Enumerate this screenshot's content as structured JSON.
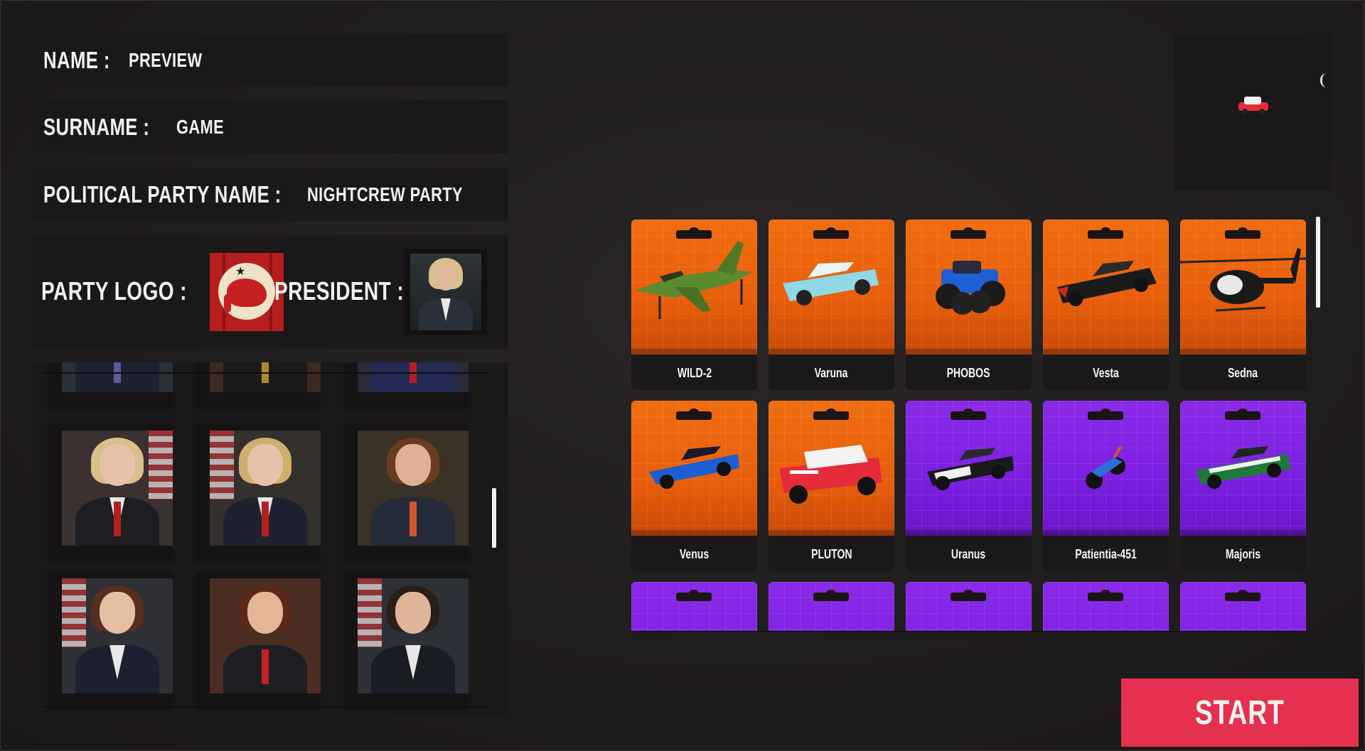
{
  "form": {
    "name_label": "NAME :",
    "name_value": "PREVIEW",
    "surname_label": "SURNAME :",
    "surname_value": "GAME",
    "party_label": "POLITICAL PARTY NAME :",
    "party_value": "NIGHTCREW PARTY",
    "logo_label": "PARTY LOGO :",
    "president_label": "PRESIDENT :"
  },
  "vehicles": [
    {
      "name": "WILD-2",
      "theme": "orange",
      "icon": "jet-icon",
      "color": "#5c8a2e"
    },
    {
      "name": "Varuna",
      "theme": "orange",
      "icon": "classic-car-icon",
      "color": "#8fd8e6"
    },
    {
      "name": "PHOBOS",
      "theme": "orange",
      "icon": "monster-truck-icon",
      "color": "#1f5fd6"
    },
    {
      "name": "Vesta",
      "theme": "orange",
      "icon": "muscle-car-icon",
      "color": "#1a1a1a"
    },
    {
      "name": "Sedna",
      "theme": "orange",
      "icon": "helicopter-icon",
      "color": "#1a1a1a"
    },
    {
      "name": "Venus",
      "theme": "orange",
      "icon": "sports-car-icon",
      "color": "#1d5fd0"
    },
    {
      "name": "PLUTON",
      "theme": "orange",
      "icon": "mini-car-icon",
      "color": "#e52a3a"
    },
    {
      "name": "Uranus",
      "theme": "purple",
      "icon": "police-car-icon",
      "color": "#1a1a1a"
    },
    {
      "name": "Patientia-451",
      "theme": "purple",
      "icon": "motorbike-icon",
      "color": "#2d6fd8"
    },
    {
      "name": "Majoris",
      "theme": "purple",
      "icon": "green-muscle-car-icon",
      "color": "#1f7a3a"
    }
  ],
  "start_label": "START",
  "colors": {
    "accent": "#e6304f",
    "orange_card": "#f06d10",
    "purple_card": "#8a2be8"
  }
}
